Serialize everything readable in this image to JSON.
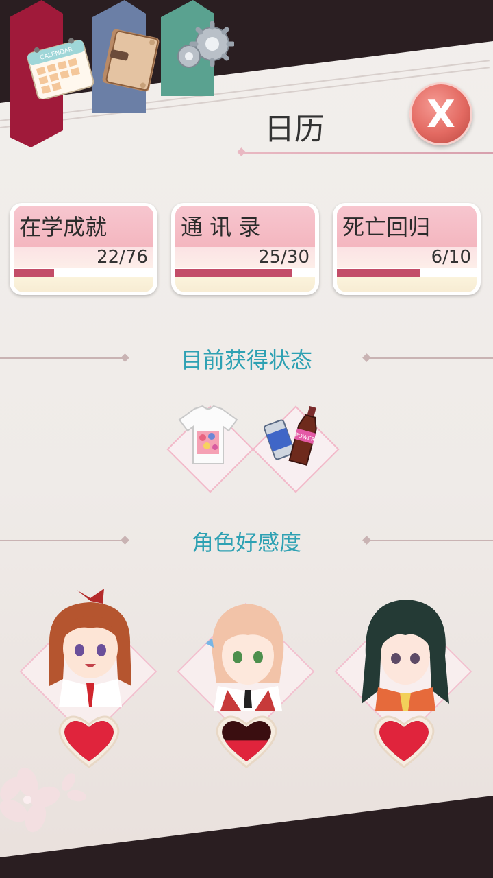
{
  "header": {
    "title": "日历",
    "close_label": "X",
    "tabs": [
      {
        "name": "calendar-tab",
        "icon": "calendar-icon",
        "icon_text": "CALENDAR"
      },
      {
        "name": "book-tab",
        "icon": "book-icon"
      },
      {
        "name": "settings-tab",
        "icon": "gear-icon"
      }
    ]
  },
  "stats": [
    {
      "label": "在学成就",
      "count": "22/76",
      "progress": 0.289
    },
    {
      "label": "通 讯 录",
      "count": "25/30",
      "progress": 0.833
    },
    {
      "label": "死亡回归",
      "count": "6/10",
      "progress": 0.6
    }
  ],
  "status_section": {
    "title": "目前获得状态",
    "items": [
      {
        "icon": "tshirt-icon"
      },
      {
        "icon": "power-drink-icon",
        "text": "POWER"
      }
    ]
  },
  "affection_section": {
    "title": "角色好感度",
    "characters": [
      {
        "icon": "character-portrait-redhair",
        "affection_level": 1.0
      },
      {
        "icon": "character-portrait-pinkhair",
        "affection_level": 0.45
      },
      {
        "icon": "character-portrait-darkhair",
        "affection_level": 1.0
      }
    ]
  },
  "colors": {
    "accent_teal": "#2ea1b3",
    "bar_fill": "#c34d68",
    "tab_red": "#a01a3a",
    "tab_blue": "#6b7fa6",
    "tab_green": "#5aa290",
    "close_red": "#e36a62"
  }
}
